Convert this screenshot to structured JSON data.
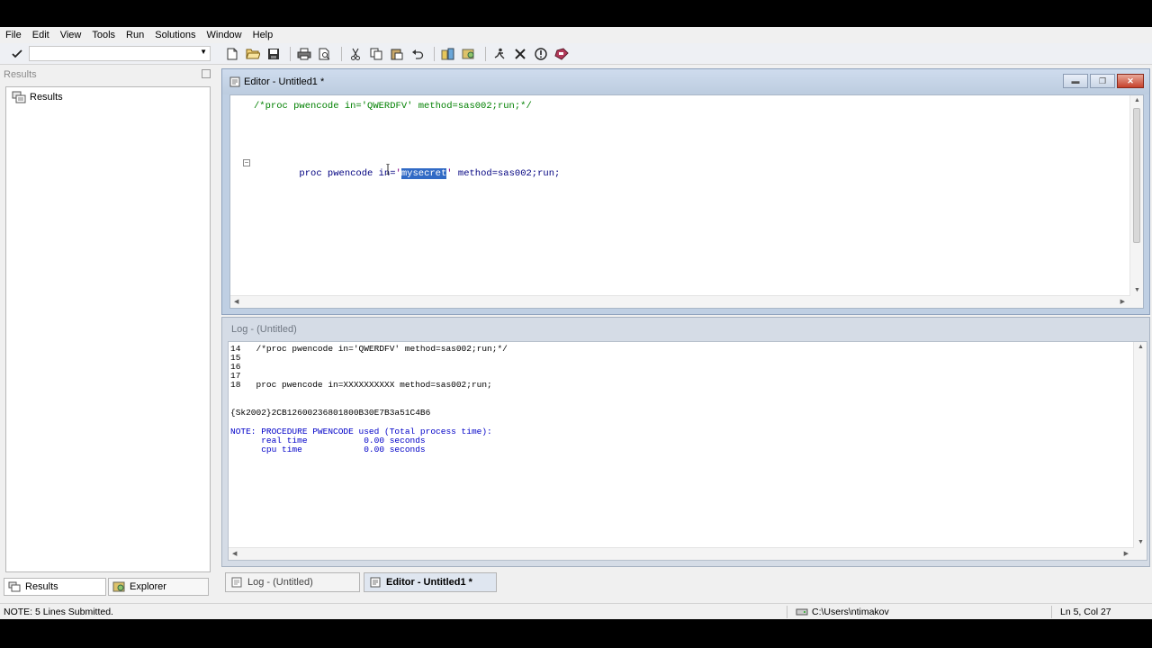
{
  "menu": [
    "File",
    "Edit",
    "View",
    "Tools",
    "Run",
    "Solutions",
    "Window",
    "Help"
  ],
  "toolbar": {
    "command_value": "",
    "icons": [
      "check-icon",
      "new-icon",
      "open-icon",
      "save-icon",
      "print-icon",
      "print-preview-icon",
      "cut-icon",
      "copy-icon",
      "paste-icon",
      "undo-icon",
      "libraries-icon",
      "explorer-icon",
      "submit-icon",
      "clear-icon",
      "help-icon",
      "options-icon"
    ]
  },
  "results_pane": {
    "title": "Results",
    "tree_root": "Results",
    "tabs": [
      "Results",
      "Explorer"
    ]
  },
  "editor": {
    "title": "Editor - Untitled1 *",
    "line1_comment": "/*proc pwencode in='QWERDFV' method=sas002;run;*/",
    "line5_kw": "proc pwencode in=",
    "line5_quote_open": "'",
    "line5_selected": "mysecret",
    "line5_quote_close": "'",
    "line5_rest": " method=sas002;run;"
  },
  "log": {
    "title": "Log - (Untitled)",
    "lines": [
      "14   /*proc pwencode in='QWERDFV' method=sas002;run;*/",
      "15",
      "16",
      "17",
      "18   proc pwencode in=XXXXXXXXXX method=sas002;run;",
      "",
      "{Sk2002}2CB12600236801800B30E7B3a51C4B6",
      "",
      "NOTE: PROCEDURE PWENCODE used (Total process time):",
      "      real time           0.00 seconds",
      "      cpu time            0.00 seconds"
    ]
  },
  "window_tabs": [
    "Log - (Untitled)",
    "Editor - Untitled1 *"
  ],
  "status": {
    "note": "NOTE: 5 Lines Submitted.",
    "path": "C:\\Users\\ntimakov",
    "position": "Ln 5, Col 27"
  },
  "colors": {
    "comment": "#008000",
    "keyword": "#000080",
    "string": "#800080",
    "selection": "#316ac5",
    "log_note": "#0000c8"
  }
}
